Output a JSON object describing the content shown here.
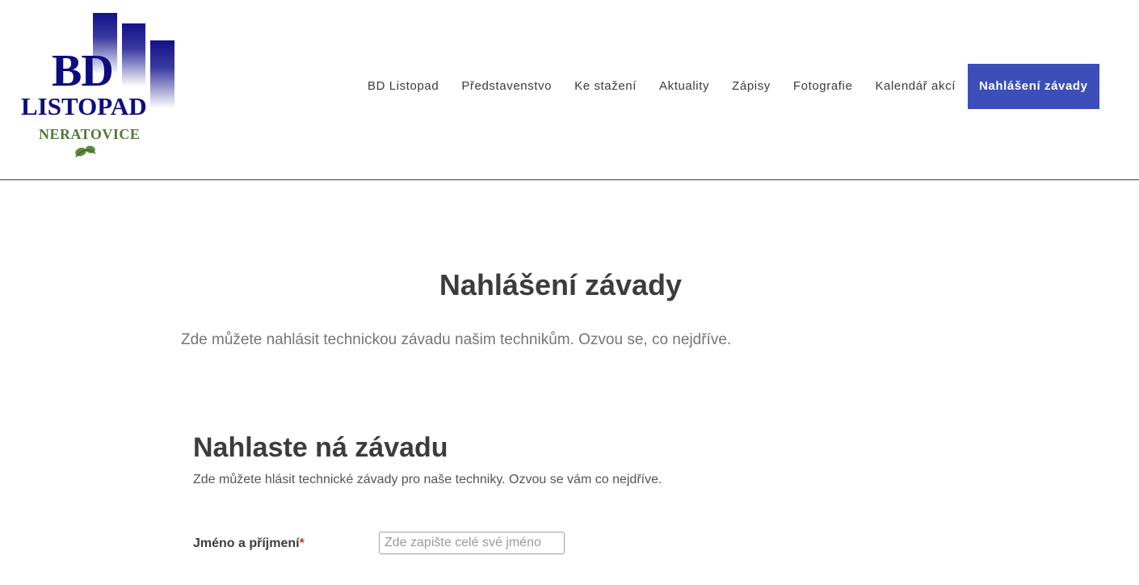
{
  "logo": {
    "bd": "BD",
    "listopad": "LISTOPAD",
    "city": "NERATOVICE",
    "colors": {
      "primary": "#0d0d80",
      "secondary": "#4f7a33"
    }
  },
  "nav": {
    "items": [
      "BD Listopad",
      "Představenstvo",
      "Ke stažení",
      "Aktuality",
      "Zápisy",
      "Fotografie",
      "Kalendář akcí"
    ],
    "active": "Nahlášení závady",
    "active_color": "#3c4fb8"
  },
  "page": {
    "title": "Nahlášení závady",
    "intro": "Zde můžete nahlásit technickou závadu našim technikům. Ozvou se, co nejdříve."
  },
  "form": {
    "title": "Nahlaste ná závadu",
    "description": "Zde můžete hlásit technické závady pro naše techniky. Ozvou se vám co nejdříve.",
    "name_field": {
      "label": "Jméno a příjmení",
      "required_mark": "*",
      "placeholder": "Zde zapište celé své jméno",
      "value": ""
    }
  }
}
